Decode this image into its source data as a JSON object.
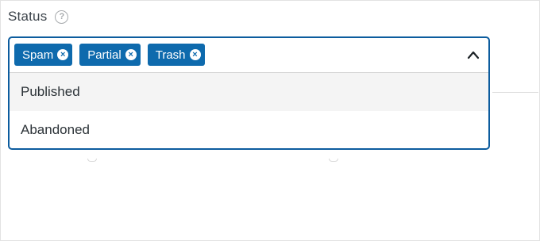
{
  "field": {
    "label": "Status",
    "help_glyph": "?"
  },
  "selected_tags": [
    {
      "label": "Spam",
      "remove_glyph": "×"
    },
    {
      "label": "Partial",
      "remove_glyph": "×"
    },
    {
      "label": "Trash",
      "remove_glyph": "×"
    }
  ],
  "toggle_icon": "chevron-up-icon",
  "options": [
    {
      "label": "Published",
      "highlighted": true
    },
    {
      "label": "Abandoned",
      "highlighted": false
    }
  ],
  "colors": {
    "accent_border": "#0c5c9e",
    "tag_background": "#0e6aad",
    "highlight_background": "#f4f4f4"
  }
}
